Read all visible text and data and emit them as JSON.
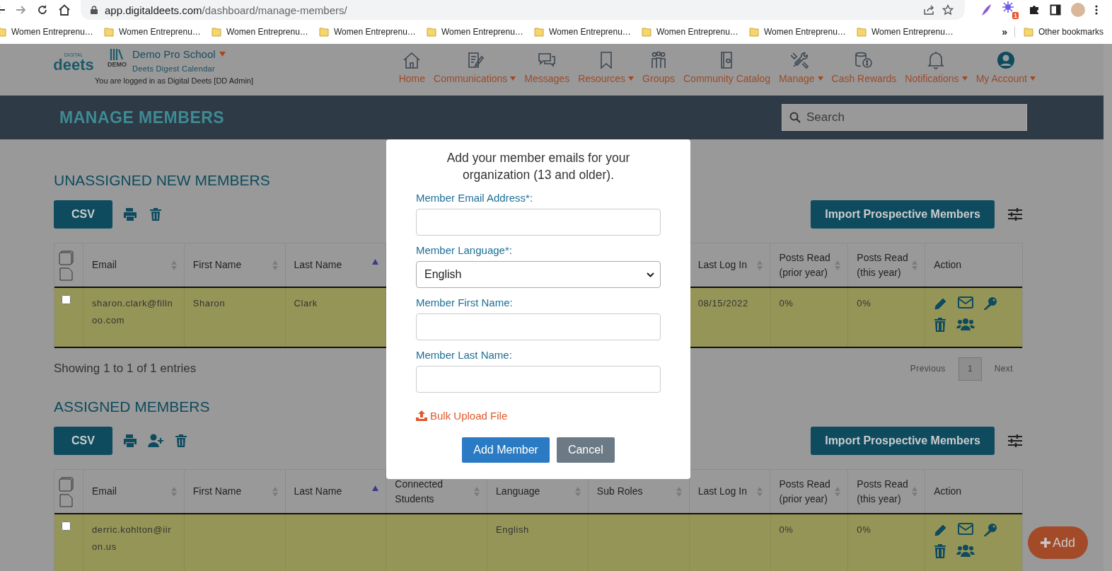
{
  "browser": {
    "url_host": "app.digitaldeets.com",
    "url_path": "/dashboard/manage-members/",
    "extension_badge": "1",
    "bookmarks": [
      "Women Entreprenu…",
      "Women Entreprenu…",
      "Women Entreprenu…",
      "Women Entreprenu…",
      "Women Entreprenu…",
      "Women Entreprenu…",
      "Women Entreprenu…",
      "Women Entreprenu…",
      "Women Entreprenu…"
    ],
    "overflow": "»",
    "other_bookmarks": "Other bookmarks"
  },
  "header": {
    "logo_small": "DIGITAL",
    "logo_main": "deets",
    "school_badge": "DEMO",
    "school": "Demo Pro School",
    "calendar": "Deets Digest Calendar",
    "login_note": "You are logged in as Digital Deets [DD Admin]",
    "nav": [
      {
        "kind": "home",
        "label": "Home",
        "dropdown": false
      },
      {
        "kind": "document",
        "label": "Communications",
        "dropdown": true
      },
      {
        "kind": "chat",
        "label": "Messages",
        "dropdown": false
      },
      {
        "kind": "bookmark",
        "label": "Resources",
        "dropdown": true
      },
      {
        "kind": "people",
        "label": "Groups",
        "dropdown": false
      },
      {
        "kind": "catalog",
        "label": "Community Catalog",
        "dropdown": false
      },
      {
        "kind": "tools",
        "label": "Manage",
        "dropdown": true
      },
      {
        "kind": "coins",
        "label": "Cash Rewards",
        "dropdown": false
      },
      {
        "kind": "bell",
        "label": "Notifications",
        "dropdown": true
      },
      {
        "kind": "account",
        "label": "My Account",
        "dropdown": true
      }
    ]
  },
  "banner": {
    "title": "MANAGE MEMBERS",
    "search_placeholder": "Search"
  },
  "sections": [
    {
      "title": "UNASSIGNED NEW MEMBERS",
      "csv": "CSV",
      "tools": [
        {
          "kind": "print"
        },
        {
          "kind": "trash"
        }
      ],
      "import": "Import Prospective Members",
      "columns": [
        {
          "kind": "email",
          "label": "Email",
          "sortable": true,
          "sorted": false
        },
        {
          "kind": "first_name",
          "label": "First Name",
          "sortable": true,
          "sorted": false
        },
        {
          "kind": "last_name",
          "label": "Last Name",
          "sortable": true,
          "sorted": true
        },
        {
          "kind": "last_log_in",
          "label": "Last Log In",
          "sortable": true,
          "sorted": false
        },
        {
          "kind": "posts_prior",
          "label": "Posts Read (prior year)",
          "sortable": true,
          "sorted": false
        },
        {
          "kind": "posts_this",
          "label": "Posts Read (this year)",
          "sortable": true,
          "sorted": false
        },
        {
          "kind": "action",
          "label": "Action"
        }
      ],
      "rows": [
        {
          "selected": false,
          "email": "sharon.clark@fillnoo.com",
          "first_name": "Sharon",
          "last_name": "Clark",
          "last_log_in": "08/15/2022",
          "posts_prior": "0%",
          "posts_this": "0%"
        }
      ],
      "pagination": {
        "info": "Showing 1 to 1 of 1 entries",
        "previous": "Previous",
        "pages": [
          {
            "label": "1",
            "selected": true
          }
        ],
        "next": "Next"
      }
    },
    {
      "title": "ASSIGNED MEMBERS",
      "csv": "CSV",
      "tools": [
        {
          "kind": "print"
        },
        {
          "kind": "user-plus"
        },
        {
          "kind": "trash"
        }
      ],
      "import": "Import Prospective Members",
      "columns": [
        {
          "kind": "email",
          "label": "Email",
          "sortable": true,
          "sorted": false
        },
        {
          "kind": "first_name",
          "label": "First Name",
          "sortable": true,
          "sorted": false
        },
        {
          "kind": "last_name",
          "label": "Last Name",
          "sortable": true,
          "sorted": true
        },
        {
          "kind": "connected",
          "label": "Connected Students",
          "sortable": true,
          "sorted": false
        },
        {
          "kind": "language",
          "label": "Language",
          "sortable": true,
          "sorted": false
        },
        {
          "kind": "sub_roles",
          "label": "Sub Roles",
          "sortable": true,
          "sorted": false
        },
        {
          "kind": "last_log_in",
          "label": "Last Log In",
          "sortable": true,
          "sorted": false
        },
        {
          "kind": "posts_prior",
          "label": "Posts Read (prior year)",
          "sortable": true,
          "sorted": false
        },
        {
          "kind": "posts_this",
          "label": "Posts Read (this year)",
          "sortable": true,
          "sorted": false
        },
        {
          "kind": "action",
          "label": "Action"
        }
      ],
      "rows": [
        {
          "selected": false,
          "email": "derric.kohlton@iiron.us",
          "language": "English",
          "posts_prior": "0%",
          "posts_this": "0%"
        }
      ]
    }
  ],
  "modal": {
    "intro": "Add your member emails for your organization (13 and older).",
    "fields": [
      {
        "kind": "input",
        "label": "Member Email Address*:"
      },
      {
        "kind": "select",
        "label": "Member Language*:",
        "value": "English"
      },
      {
        "kind": "input",
        "label": "Member First Name:"
      },
      {
        "kind": "input",
        "label": "Member Last Name:"
      }
    ],
    "upload": "Bulk Upload File",
    "buttons": [
      {
        "kind": "primary",
        "label": "Add Member"
      },
      {
        "kind": "secondary",
        "label": "Cancel"
      }
    ]
  },
  "fab": {
    "label": "Add"
  }
}
